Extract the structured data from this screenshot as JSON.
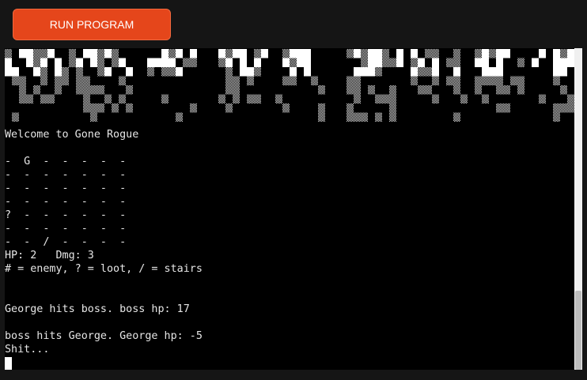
{
  "toolbar": {
    "run_label": "RUN PROGRAM",
    "accent_color": "#e5461b"
  },
  "terminal": {
    "lines": [
      "Welcome to Gone Rogue",
      "",
      "-  G  -  -  -  -  -",
      "-  -  -  -  -  -  -",
      "-  -  -  -  -  -  -",
      "-  -  -  -  -  -  -",
      "?  -  -  -  -  -  -",
      "-  -  -  -  -  -  -",
      "-  -  /  -  -  -  -",
      "HP: 2   Dmg: 3",
      "# = enemy, ? = loot, / = stairs",
      "",
      "",
      "George hits boss. boss hp: 17",
      "",
      "boss hits George. George hp: -5",
      "Shit..."
    ]
  }
}
